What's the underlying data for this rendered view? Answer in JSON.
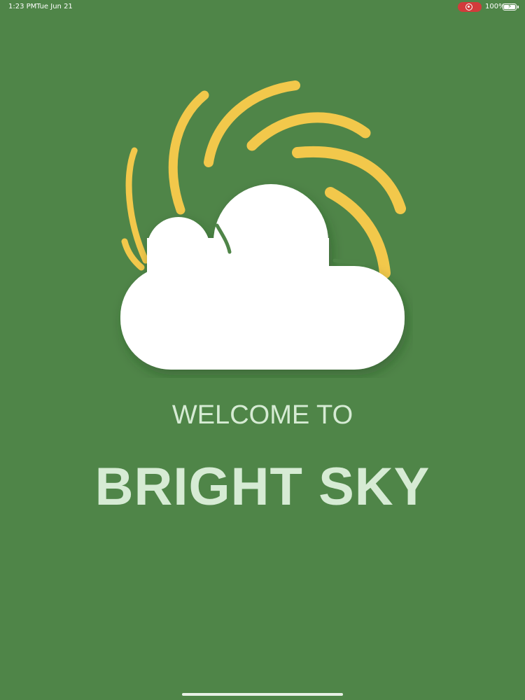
{
  "status_bar": {
    "time": "1:23 PM",
    "date": "Tue Jun 21",
    "battery": "100%",
    "record_icon": "screen-record-icon",
    "battery_icon": "battery-charging-icon"
  },
  "splash": {
    "welcome": "WELCOME TO",
    "title": "BRIGHT SKY",
    "logo": "sun-cloud-logo"
  },
  "colors": {
    "background": "#4f8548",
    "sun_rays": "#f2c84b",
    "cloud": "#ffffff",
    "text": "#d6ebd4",
    "record_pill": "#d23b3b"
  }
}
